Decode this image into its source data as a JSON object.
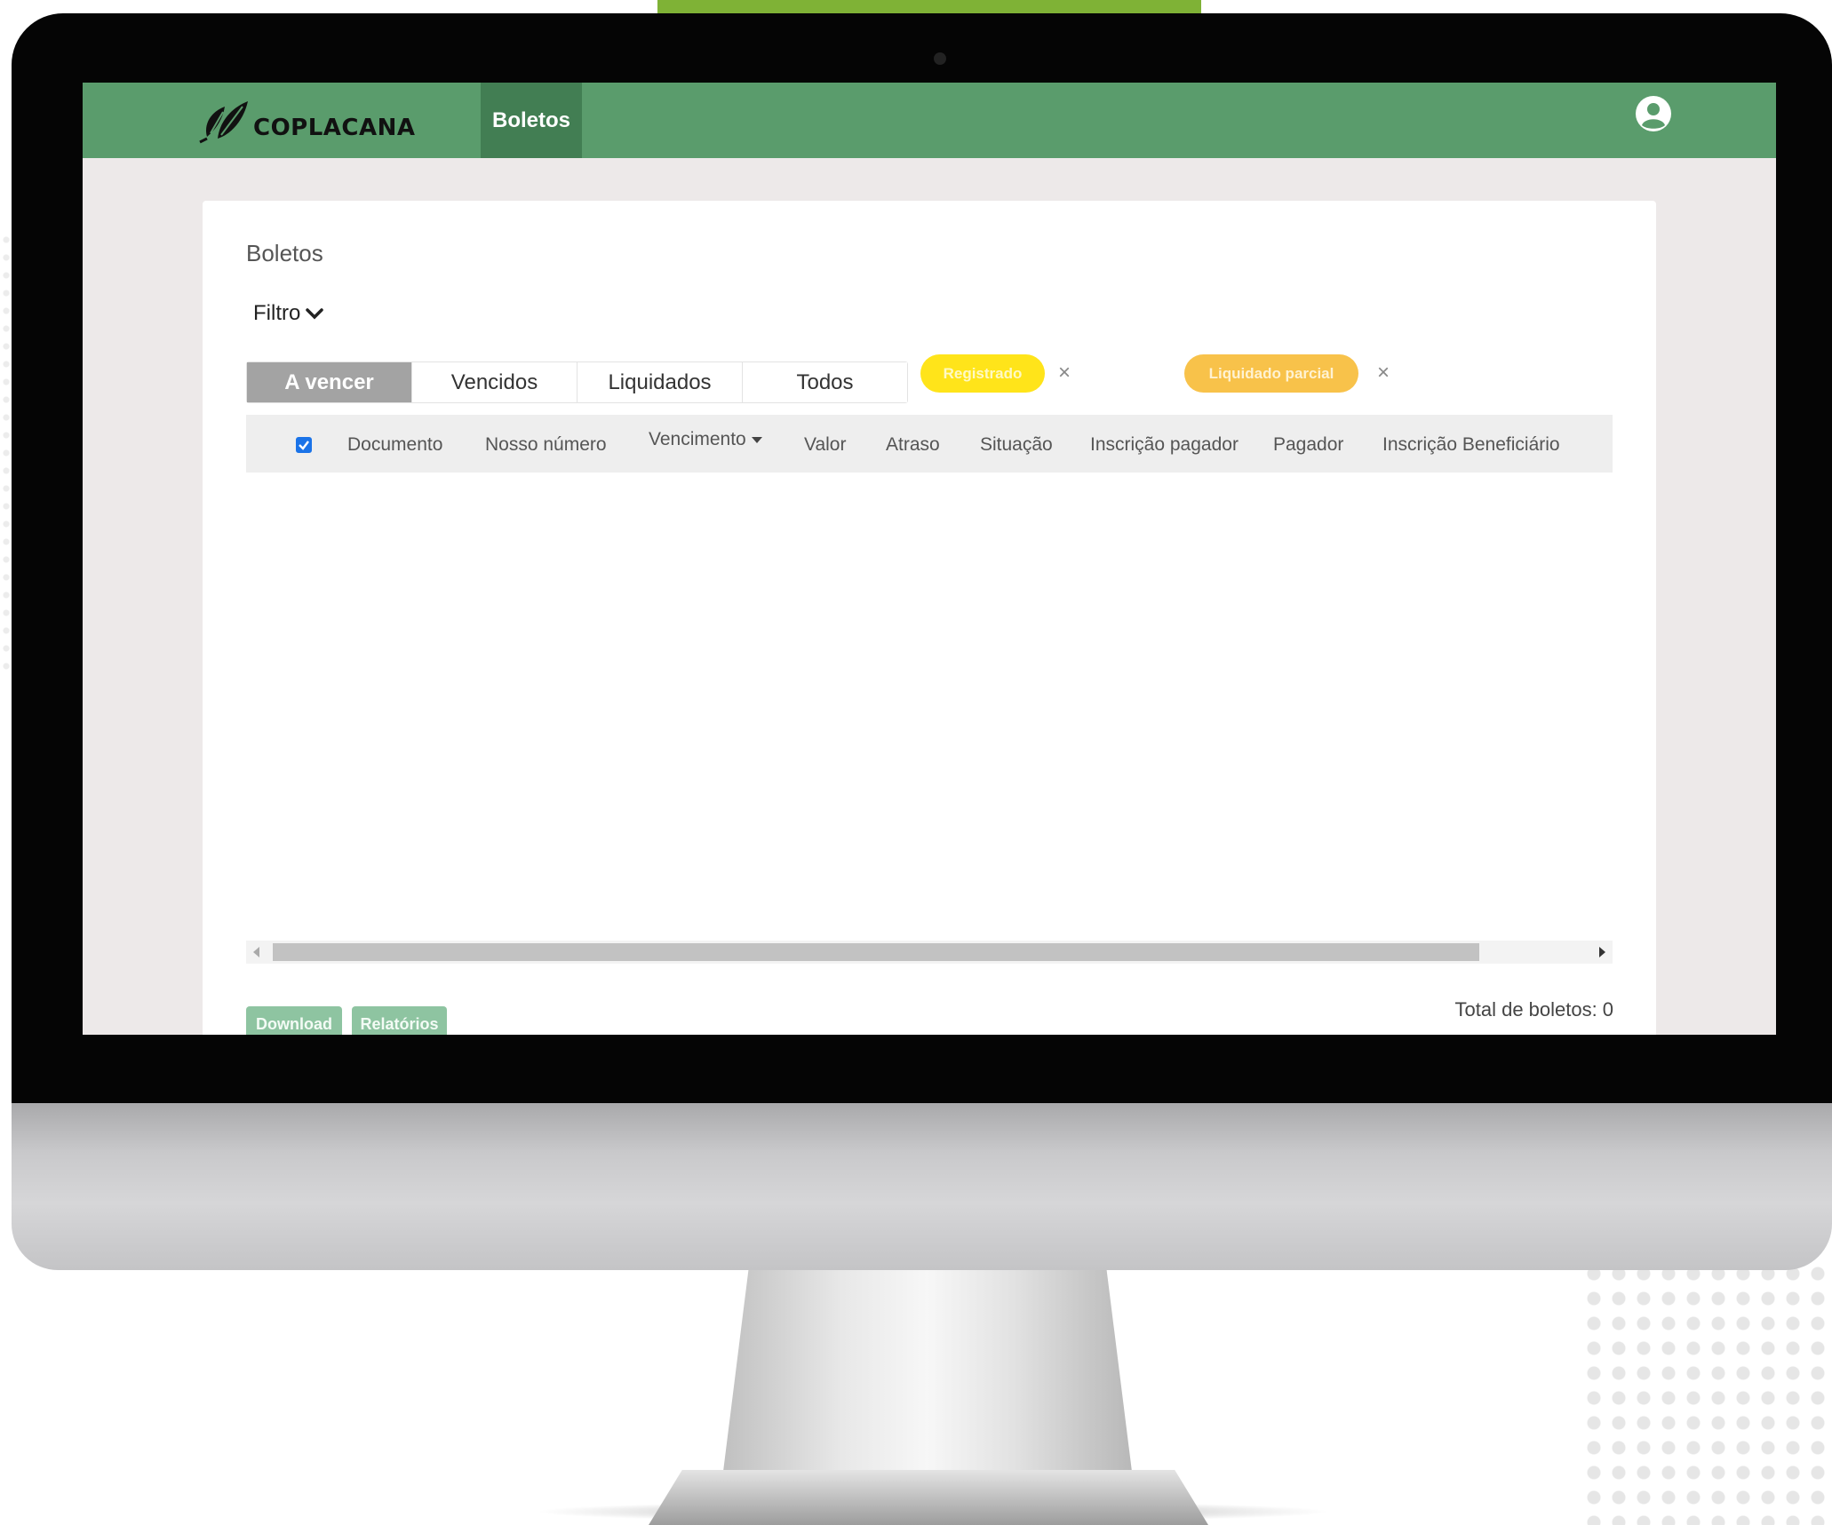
{
  "app": {
    "brand": "COPLACANA"
  },
  "navbar": {
    "active_tab": "Boletos",
    "user_icon": "user-circle-icon"
  },
  "page": {
    "title": "Boletos"
  },
  "filter": {
    "label": "Filtro",
    "icon": "chevron-down-icon"
  },
  "tabs": [
    {
      "label": "A vencer",
      "active": true
    },
    {
      "label": "Vencidos",
      "active": false
    },
    {
      "label": "Liquidados",
      "active": false
    },
    {
      "label": "Todos",
      "active": false
    }
  ],
  "chips": [
    {
      "label": "Registrado",
      "color": "#ffe41a",
      "remove": "×"
    },
    {
      "label": "Liquidado parcial",
      "color": "#f8c24a",
      "remove": "×"
    }
  ],
  "table": {
    "select_all_checked": true,
    "columns": [
      "Documento",
      "Nosso número",
      "Vencimento",
      "Valor",
      "Atraso",
      "Situação",
      "Inscrição pagador",
      "Pagador",
      "Inscrição Beneficiário"
    ],
    "sorted_column": "Vencimento",
    "rows": []
  },
  "actions": {
    "download": "Download",
    "reports": "Relatórios"
  },
  "summary": {
    "total_label": "Total de boletos:",
    "total_value": "0"
  },
  "colors": {
    "navbar": "#5a9c6c",
    "nav_active": "#427e53",
    "button": "#8ec4a1",
    "accent_bar": "#7fb236"
  }
}
